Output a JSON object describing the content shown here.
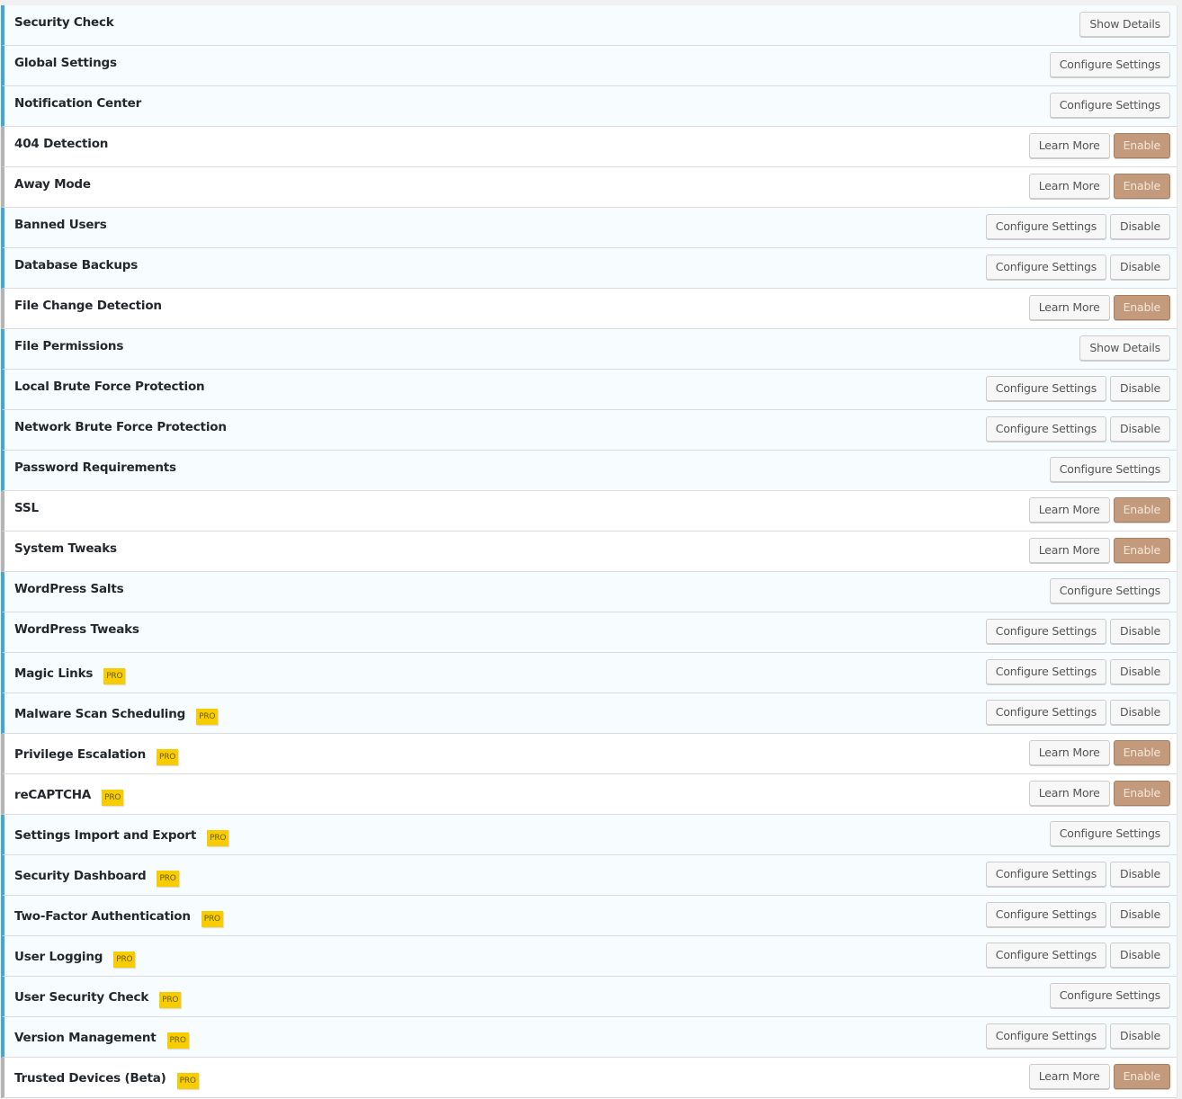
{
  "colors": {
    "active_border": "#46a4d6",
    "inactive_border": "#b4b4b4",
    "enable_button": "#c39b7c",
    "pro_badge": "#f8cd00"
  },
  "pro_label": "PRO",
  "modules": [
    {
      "title": "Security Check",
      "active": true,
      "pro": false,
      "buttons": [
        "Show Details"
      ]
    },
    {
      "title": "Global Settings",
      "active": true,
      "pro": false,
      "buttons": [
        "Configure Settings"
      ]
    },
    {
      "title": "Notification Center",
      "active": true,
      "pro": false,
      "buttons": [
        "Configure Settings"
      ]
    },
    {
      "title": "404 Detection",
      "active": false,
      "pro": false,
      "buttons": [
        "Learn More",
        "Enable"
      ]
    },
    {
      "title": "Away Mode",
      "active": false,
      "pro": false,
      "buttons": [
        "Learn More",
        "Enable"
      ]
    },
    {
      "title": "Banned Users",
      "active": true,
      "pro": false,
      "buttons": [
        "Configure Settings",
        "Disable"
      ]
    },
    {
      "title": "Database Backups",
      "active": true,
      "pro": false,
      "buttons": [
        "Configure Settings",
        "Disable"
      ]
    },
    {
      "title": "File Change Detection",
      "active": false,
      "pro": false,
      "buttons": [
        "Learn More",
        "Enable"
      ]
    },
    {
      "title": "File Permissions",
      "active": true,
      "pro": false,
      "buttons": [
        "Show Details"
      ]
    },
    {
      "title": "Local Brute Force Protection",
      "active": true,
      "pro": false,
      "buttons": [
        "Configure Settings",
        "Disable"
      ]
    },
    {
      "title": "Network Brute Force Protection",
      "active": true,
      "pro": false,
      "buttons": [
        "Configure Settings",
        "Disable"
      ]
    },
    {
      "title": "Password Requirements",
      "active": true,
      "pro": false,
      "buttons": [
        "Configure Settings"
      ]
    },
    {
      "title": "SSL",
      "active": false,
      "pro": false,
      "buttons": [
        "Learn More",
        "Enable"
      ]
    },
    {
      "title": "System Tweaks",
      "active": false,
      "pro": false,
      "buttons": [
        "Learn More",
        "Enable"
      ]
    },
    {
      "title": "WordPress Salts",
      "active": true,
      "pro": false,
      "buttons": [
        "Configure Settings"
      ]
    },
    {
      "title": "WordPress Tweaks",
      "active": true,
      "pro": false,
      "buttons": [
        "Configure Settings",
        "Disable"
      ]
    },
    {
      "title": "Magic Links",
      "active": true,
      "pro": true,
      "buttons": [
        "Configure Settings",
        "Disable"
      ]
    },
    {
      "title": "Malware Scan Scheduling",
      "active": true,
      "pro": true,
      "buttons": [
        "Configure Settings",
        "Disable"
      ]
    },
    {
      "title": "Privilege Escalation",
      "active": false,
      "pro": true,
      "buttons": [
        "Learn More",
        "Enable"
      ]
    },
    {
      "title": "reCAPTCHA",
      "active": false,
      "pro": true,
      "buttons": [
        "Learn More",
        "Enable"
      ]
    },
    {
      "title": "Settings Import and Export",
      "active": true,
      "pro": true,
      "buttons": [
        "Configure Settings"
      ]
    },
    {
      "title": "Security Dashboard",
      "active": true,
      "pro": true,
      "buttons": [
        "Configure Settings",
        "Disable"
      ]
    },
    {
      "title": "Two-Factor Authentication",
      "active": true,
      "pro": true,
      "buttons": [
        "Configure Settings",
        "Disable"
      ]
    },
    {
      "title": "User Logging",
      "active": true,
      "pro": true,
      "buttons": [
        "Configure Settings",
        "Disable"
      ]
    },
    {
      "title": "User Security Check",
      "active": true,
      "pro": true,
      "buttons": [
        "Configure Settings"
      ]
    },
    {
      "title": "Version Management",
      "active": true,
      "pro": true,
      "buttons": [
        "Configure Settings",
        "Disable"
      ]
    },
    {
      "title": "Trusted Devices (Beta)",
      "active": false,
      "pro": true,
      "buttons": [
        "Learn More",
        "Enable"
      ]
    }
  ]
}
